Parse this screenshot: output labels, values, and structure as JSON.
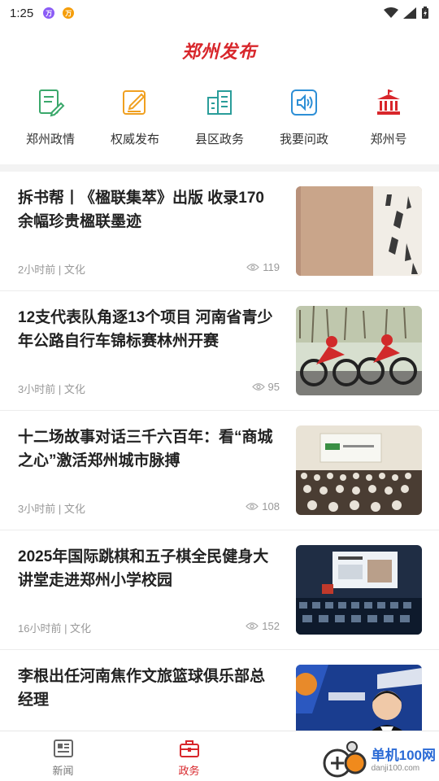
{
  "status": {
    "time": "1:25",
    "notif1": "万",
    "notif2": "万"
  },
  "header": {
    "brand": "郑州发布"
  },
  "quicknav": [
    {
      "label": "郑州政情",
      "icon": "document-edit-icon"
    },
    {
      "label": "权威发布",
      "icon": "edit-note-icon"
    },
    {
      "label": "县区政务",
      "icon": "buildings-icon"
    },
    {
      "label": "我要问政",
      "icon": "speaker-icon"
    },
    {
      "label": "郑州号",
      "icon": "government-building-icon"
    }
  ],
  "articles": [
    {
      "title": "拆书帮丨《楹联集萃》出版 收录170余幅珍贵楹联墨迹",
      "meta": "2小时前 | 文化",
      "views": "119",
      "thumb": "calligraphy-book"
    },
    {
      "title": "12支代表队角逐13个项目 河南省青少年公路自行车锦标赛林州开赛",
      "meta": "3小时前 | 文化",
      "views": "95",
      "thumb": "cycling"
    },
    {
      "title": "十二场故事对话三千六百年：看“商城之心”激活郑州城市脉搏",
      "meta": "3小时前 | 文化",
      "views": "108",
      "thumb": "auditorium"
    },
    {
      "title": "2025年国际跳棋和五子棋全民健身大讲堂走进郑州小学校园",
      "meta": "16小时前 | 文化",
      "views": "152",
      "thumb": "lecture-hall"
    },
    {
      "title": "李根出任河南焦作文旅篮球俱乐部总经理",
      "meta": "",
      "views": "",
      "thumb": "basketball"
    }
  ],
  "tabs": [
    {
      "label": "新闻",
      "active": false
    },
    {
      "label": "政务",
      "active": true
    },
    {
      "label": "",
      "active": false
    }
  ],
  "watermark": {
    "title": "单机100网",
    "url": "danji100.com"
  },
  "colors": {
    "accent": "#d8262b",
    "icon_green": "#3aa86b",
    "icon_orange": "#f0a020",
    "icon_teal": "#2a9d9a",
    "icon_blue": "#2d8fd6"
  }
}
